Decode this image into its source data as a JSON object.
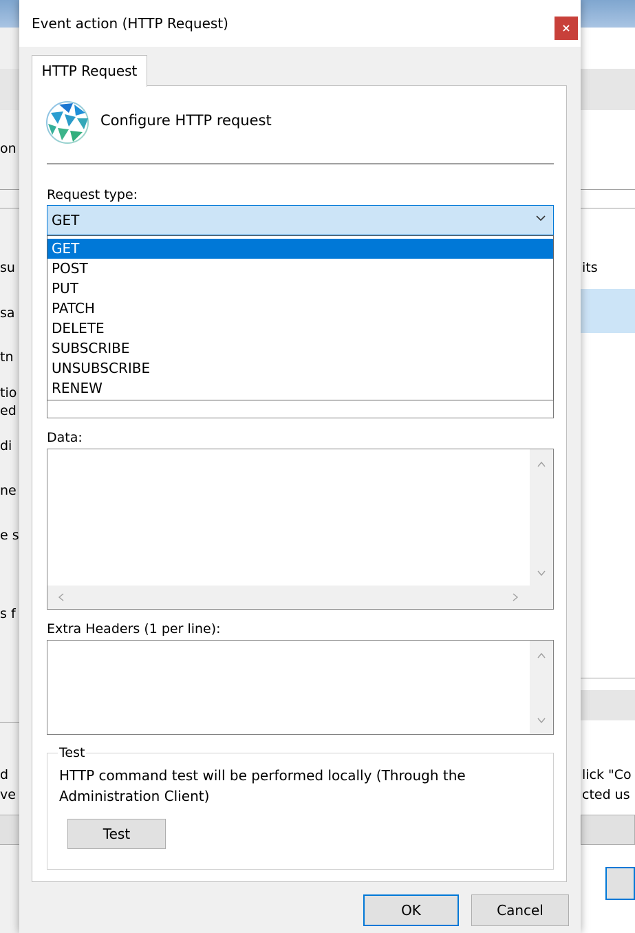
{
  "background_window": {
    "left_fragments": [
      "on",
      "su",
      "sa",
      "tn",
      "tio",
      "ed",
      "di",
      "ne",
      "e s",
      "s f",
      "d",
      "ve"
    ],
    "right_fragments": [
      "its",
      "lick \"Co",
      "cted us"
    ]
  },
  "dialog": {
    "title": "Event action (HTTP Request)",
    "close_label": "×",
    "tab_label": "HTTP Request",
    "header_text": "Configure HTTP request",
    "request_type_label": "Request type:",
    "request_type_value": "GET",
    "request_type_options": [
      "GET",
      "POST",
      "PUT",
      "PATCH",
      "DELETE",
      "SUBSCRIBE",
      "UNSUBSCRIBE",
      "RENEW"
    ],
    "data_label": "Data:",
    "data_value": "",
    "extra_headers_label": "Extra Headers (1 per line):",
    "extra_headers_value": "",
    "test_group": {
      "legend": "Test",
      "description": "HTTP command test will be performed locally (Through the Administration Client)",
      "test_button": "Test"
    },
    "ok_button": "OK",
    "cancel_button": "Cancel"
  },
  "colors": {
    "accent": "#0078d7",
    "close_button": "#c8403a",
    "combo_background": "#cce4f7"
  }
}
